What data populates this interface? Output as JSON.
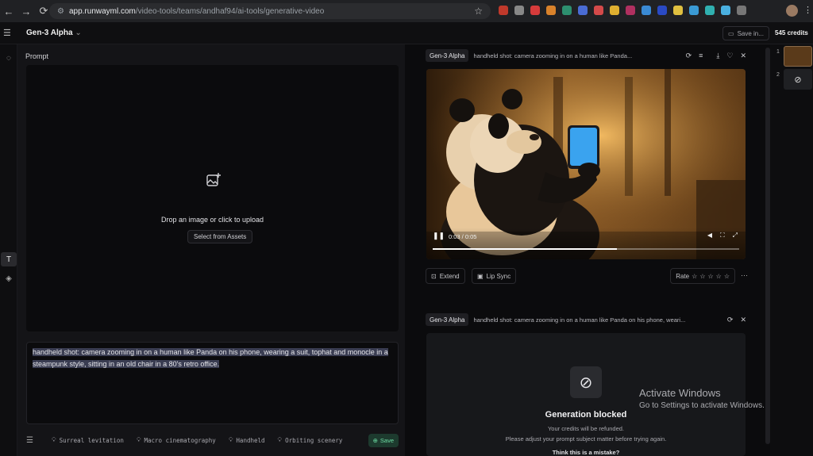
{
  "browser": {
    "url_host": "app.runwayml.com",
    "url_path": "/video-tools/teams/andhaf94/ai-tools/generative-video"
  },
  "header": {
    "model_title": "Gen-3 Alpha",
    "save_in": "Save in...",
    "credits": "545 credits"
  },
  "prompt_panel": {
    "label": "Prompt",
    "upload_text": "Drop an image or click to upload",
    "select_assets": "Select from Assets",
    "prompt_text": "handheld shot: camera zooming in on a human like Panda on his phone, wearing a suit, tophat and monocle in a steampunk style, sitting in an old chair in a 80's retro office.",
    "chips": [
      "Surreal levitation",
      "Macro cinematography",
      "Handheld",
      "Orbiting scenery"
    ],
    "save_label": "Save"
  },
  "generation_1": {
    "badge": "Gen-3 Alpha",
    "description": "handheld shot: camera zooming in on a human like Panda...",
    "timecode": "0:03 / 0:05",
    "progress": 0.6,
    "extend": "Extend",
    "lip_sync": "Lip Sync",
    "rate": "Rate"
  },
  "generation_2": {
    "badge": "Gen-3 Alpha",
    "description": "handheld shot: camera zooming in on a human like Panda on his phone, weari...",
    "blocked_title": "Generation blocked",
    "blocked_line1": "Your credits will be refunded.",
    "blocked_line2": "Please adjust your prompt subject matter before trying again.",
    "blocked_line3": "Think this is a mistake?"
  },
  "thumbnails": [
    "1",
    "2"
  ],
  "watermark": {
    "title": "Activate Windows",
    "subtitle": "Go to Settings to activate Windows."
  },
  "colors": {
    "save_accent": "#6fe0a6",
    "panel_bg": "#141417"
  }
}
